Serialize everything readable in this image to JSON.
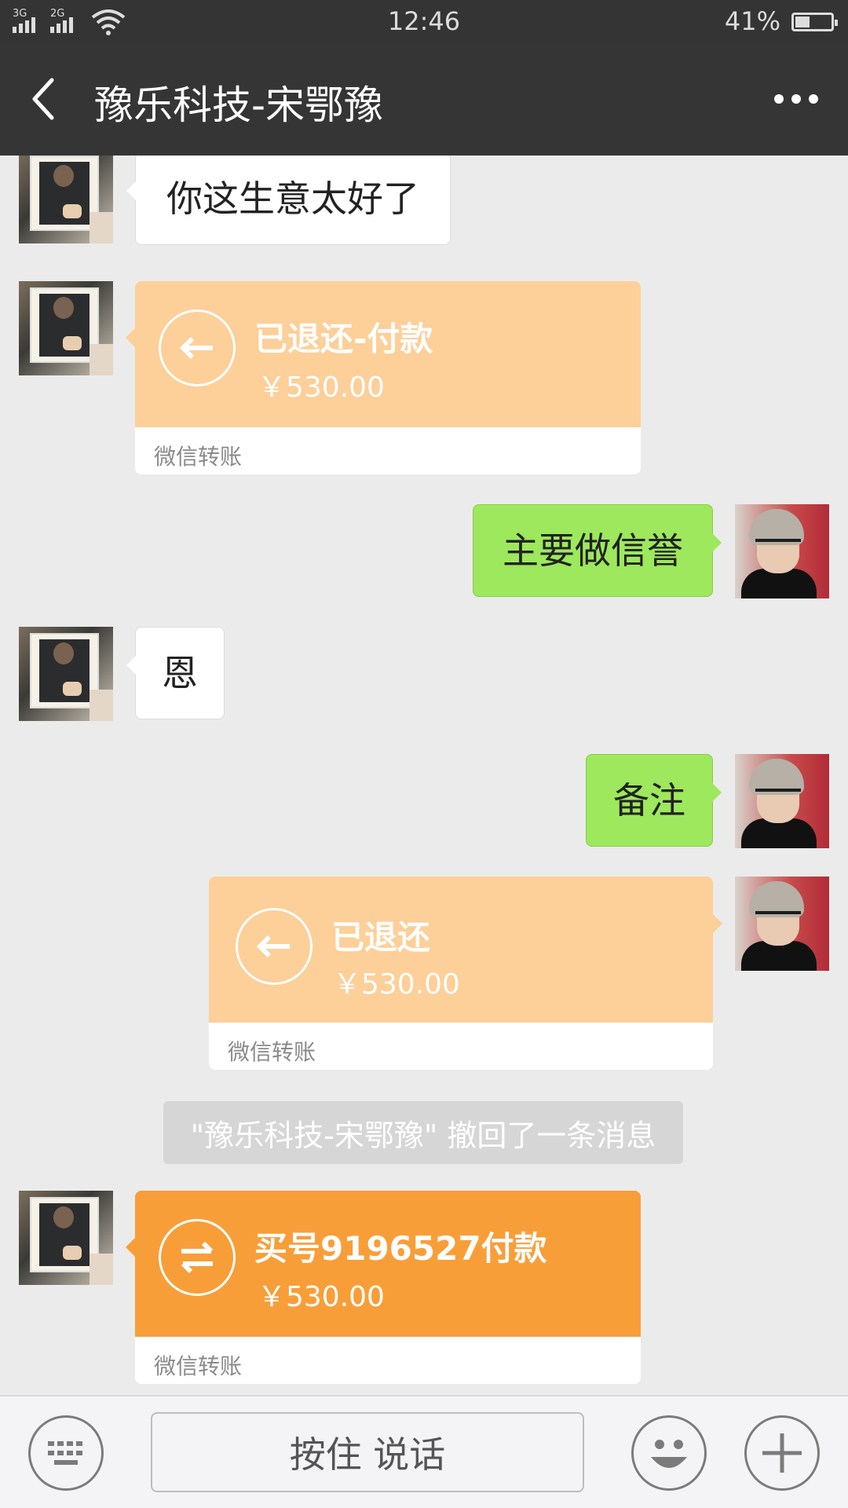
{
  "status_bar": {
    "signal_1_label": "3G",
    "signal_2_label": "2G",
    "time": "12:46",
    "battery_percent": "41%",
    "battery_level": 0.41
  },
  "nav": {
    "title": "豫乐科技-宋鄂豫"
  },
  "messages": {
    "m1": "你这生意太好了",
    "m2_title": "已退还-付款",
    "m2_amount": "￥530.00",
    "m2_footer": "微信转账",
    "m3": "主要做信誉",
    "m4": "恩",
    "m5": "备注",
    "m6_title": "已退还",
    "m6_amount": "￥530.00",
    "m6_footer": "微信转账",
    "notice": "\"豫乐科技-宋鄂豫\" 撤回了一条消息",
    "m7_title": "买号9196527付款",
    "m7_amount": "￥530.00",
    "m7_footer": "微信转账"
  },
  "input_bar": {
    "talk_label": "按住 说话"
  },
  "colors": {
    "nav_bg": "#353535",
    "chat_bg": "#ebebeb",
    "green_bubble": "#9de85c",
    "transfer_refunded": "#fdcf99",
    "transfer_active": "#f89e39"
  }
}
